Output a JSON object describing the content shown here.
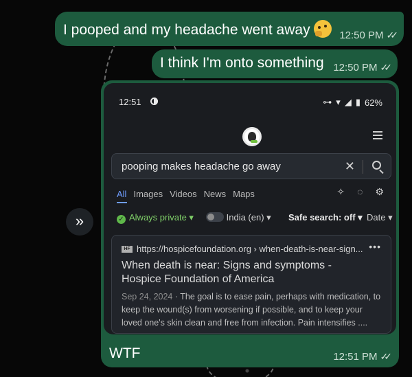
{
  "messages": [
    {
      "text": "I pooped and my headache went away",
      "emoji": "thinking-face",
      "time": "12:50 PM",
      "ticks": "✓✓"
    },
    {
      "text": "I think I'm onto something",
      "time": "12:50 PM",
      "ticks": "✓✓"
    }
  ],
  "media_message": {
    "caption": "WTF",
    "time": "12:51 PM",
    "ticks": "✓✓",
    "screenshot": {
      "status_time": "12:51",
      "battery": "62%",
      "search_query": "pooping makes headache go away",
      "tabs": [
        "All",
        "Images",
        "Videos",
        "News",
        "Maps"
      ],
      "active_tab": "All",
      "filters": {
        "privacy": "Always private",
        "region": "India (en)",
        "safe_search": "Safe search: off",
        "date": "Date"
      },
      "result": {
        "url": "https://hospicefoundation.org › when-death-is-near-sign...",
        "title": "When death is near: Signs and symptoms - Hospice Foundation of America",
        "date": "Sep 24, 2024",
        "snippet": "The goal is to ease pain, perhaps with medication, to keep the wound(s) from worsening if possible, and to keep your loved one's skin clean and free from infection. Pain intensifies ...."
      }
    }
  },
  "colors": {
    "bubble": "#1d5b3e",
    "background": "#0b0b0b",
    "accent_link": "#6f9dff",
    "private_green": "#7fcf68"
  },
  "icons": [
    "forward-icon",
    "double-check-icon",
    "search-icon",
    "clear-icon",
    "menu-icon",
    "duckduckgo-logo"
  ]
}
